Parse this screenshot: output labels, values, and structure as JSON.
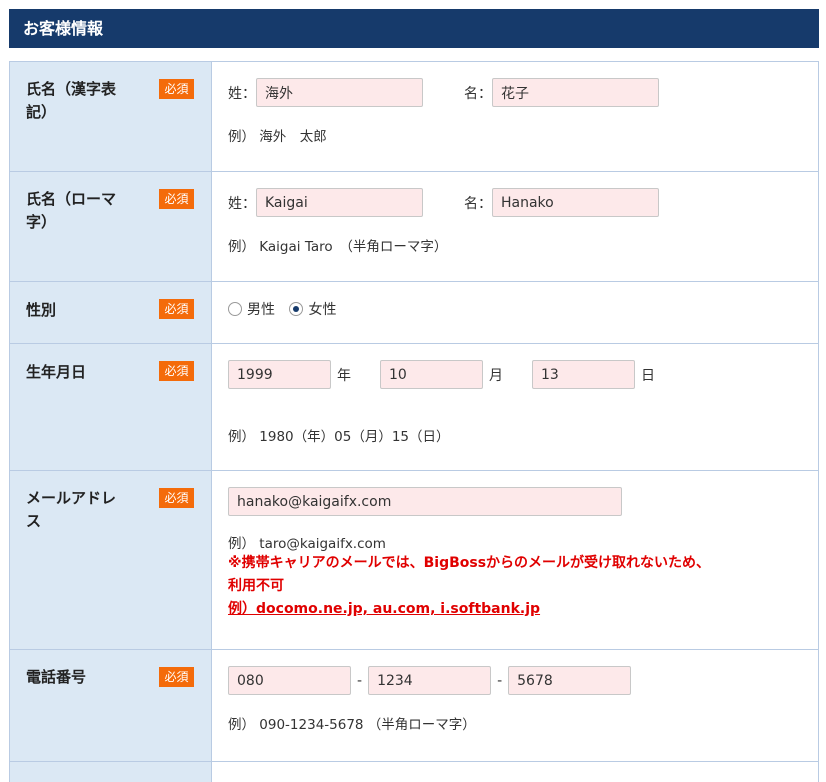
{
  "section_title": "お客様情報",
  "required_label": "必須",
  "name_kanji": {
    "label": "氏名（漢字表記）",
    "last_label": "姓：",
    "last_value": "海外",
    "first_label": "名：",
    "first_value": "花子",
    "example": "例） 海外　太郎"
  },
  "name_roman": {
    "label": "氏名（ローマ字）",
    "last_label": "姓：",
    "last_value": "Kaigai",
    "first_label": "名：",
    "first_value": "Hanako",
    "example": "例） Kaigai Taro　（半角ローマ字）"
  },
  "gender": {
    "label": "性別",
    "options": [
      {
        "label": "男性",
        "selected": false
      },
      {
        "label": "女性",
        "selected": true
      }
    ]
  },
  "birthdate": {
    "label": "生年月日",
    "year_value": "1999",
    "year_unit": "年",
    "month_value": "10",
    "month_unit": "月",
    "day_value": "13",
    "day_unit": "日",
    "example": "例） 1980（年）05（月）15（日）"
  },
  "email": {
    "label": "メールアドレス",
    "value": "hanako@kaigaifx.com",
    "example": "例） taro@kaigaifx.com",
    "warning_line1": "※携帯キャリアのメールでは、BigBossからのメールが受け取れないため、",
    "warning_line2": "利用不可",
    "warning_link": "例）docomo.ne.jp, au.com, i.softbank.jp"
  },
  "phone": {
    "label": "電話番号",
    "part1": "080",
    "part2": "1234",
    "part3": "5678",
    "separator": "-",
    "example": "例） 090-1234-5678 （半角ローマ字）"
  },
  "colors": {
    "header_bg": "#163a6b",
    "label_bg": "#dbe8f4",
    "badge_bg": "#f46b0a",
    "field_bg": "#fde9ea",
    "warning": "#e00000"
  }
}
